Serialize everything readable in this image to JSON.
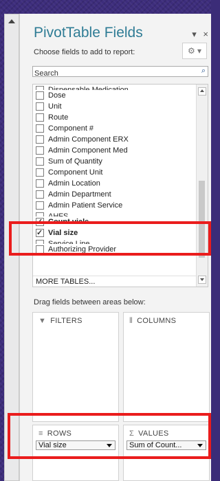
{
  "panel": {
    "title": "PivotTable Fields",
    "close_glyph": "×",
    "dropdown_glyph": "▾",
    "choose_label": "Choose fields to add to report:",
    "gear_glyph": "⚙ ▾",
    "search_placeholder": "Search",
    "search_glyph": "⌕",
    "more_tables": "MORE TABLES...",
    "drag_label": "Drag fields between areas below:"
  },
  "fields": [
    {
      "label": "Dispensable Medication",
      "checked": false,
      "partial": true
    },
    {
      "label": "Dose",
      "checked": false
    },
    {
      "label": "Unit",
      "checked": false
    },
    {
      "label": "Route",
      "checked": false
    },
    {
      "label": "Component #",
      "checked": false
    },
    {
      "label": "Admin Component ERX",
      "checked": false
    },
    {
      "label": "Admin Component Med",
      "checked": false
    },
    {
      "label": "Sum of Quantity",
      "checked": false
    },
    {
      "label": "Component Unit",
      "checked": false
    },
    {
      "label": "Admin Location",
      "checked": false
    },
    {
      "label": "Admin Department",
      "checked": false
    },
    {
      "label": "Admin Patient Service",
      "checked": false
    },
    {
      "label": "AHFS",
      "checked": false,
      "partial": true
    },
    {
      "label": "Count vials",
      "checked": true
    },
    {
      "label": "Vial size",
      "checked": true
    },
    {
      "label": "Service Line",
      "checked": false,
      "partial": true
    },
    {
      "label": "Authorizing Provider",
      "checked": false
    }
  ],
  "areas": {
    "filters": {
      "label": "FILTERS",
      "icon": "▼"
    },
    "columns": {
      "label": "COLUMNS",
      "icon": "⦀"
    },
    "rows": {
      "label": "ROWS",
      "icon": "≡",
      "value": "Vial size"
    },
    "values": {
      "label": "VALUES",
      "icon": "Σ",
      "value": "Sum of Count..."
    }
  },
  "colors": {
    "title": "#2f7c95",
    "highlight": "#ea1c1c",
    "background": "#3d2d7c"
  }
}
